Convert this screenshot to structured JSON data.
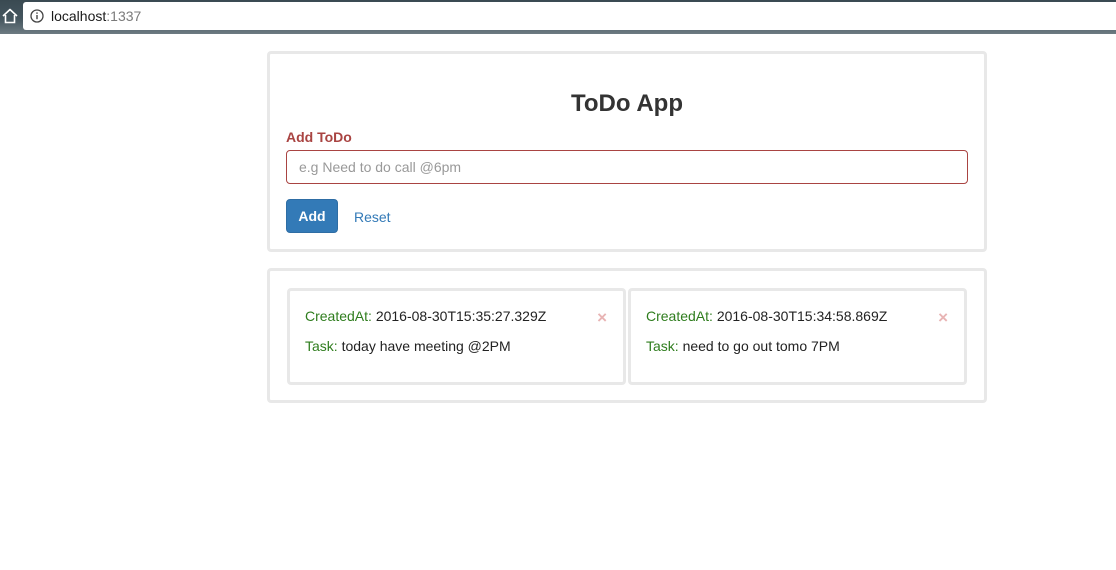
{
  "browser": {
    "url_host": "localhost",
    "url_port": ":1337"
  },
  "app": {
    "title": "ToDo App",
    "add_label": "Add ToDo",
    "input_placeholder": "e.g Need to do call @6pm",
    "input_value": "",
    "add_button_label": "Add",
    "reset_link_label": "Reset"
  },
  "todos": [
    {
      "created_label": "CreatedAt:",
      "created_value": " 2016-08-30T15:35:27.329Z",
      "task_label": "Task:",
      "task_value": " today have meeting @2PM",
      "close_glyph": "×"
    },
    {
      "created_label": "CreatedAt:",
      "created_value": " 2016-08-30T15:34:58.869Z",
      "task_label": "Task:",
      "task_value": " need to go out tomo 7PM",
      "close_glyph": "×"
    }
  ],
  "colors": {
    "label_error": "#a94442",
    "primary": "#337ab7",
    "field_label": "#2f7d1e",
    "close_icon": "#e8b4b4"
  },
  "icons": {
    "home": "home-icon",
    "info": "info-icon",
    "close": "close-icon"
  }
}
